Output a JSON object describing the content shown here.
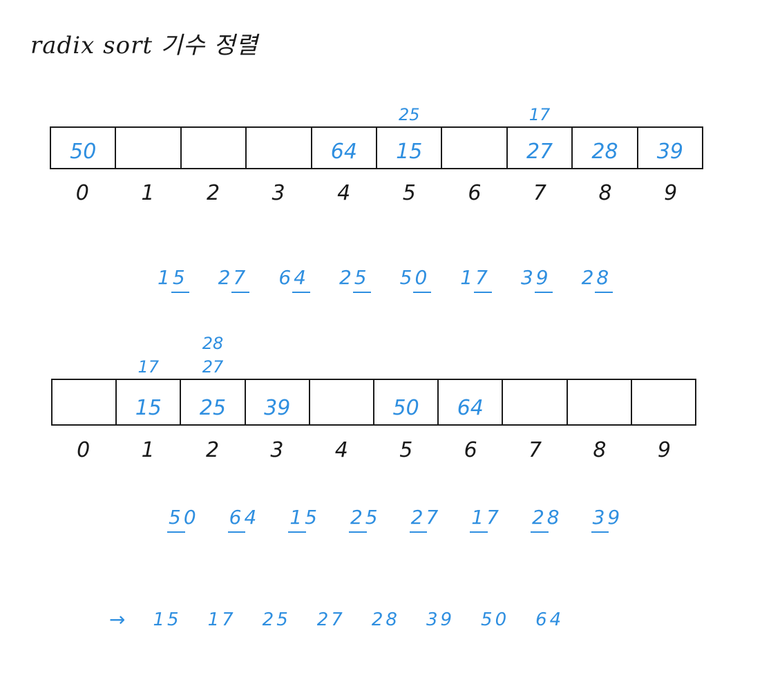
{
  "title": "radix sort 기수 정렬",
  "pass1": {
    "buckets": [
      {
        "index": "0",
        "values": [
          "50"
        ]
      },
      {
        "index": "1",
        "values": []
      },
      {
        "index": "2",
        "values": []
      },
      {
        "index": "3",
        "values": []
      },
      {
        "index": "4",
        "values": [
          "64"
        ]
      },
      {
        "index": "5",
        "values": [
          "15",
          "25"
        ]
      },
      {
        "index": "6",
        "values": []
      },
      {
        "index": "7",
        "values": [
          "27",
          "17"
        ]
      },
      {
        "index": "8",
        "values": [
          "28"
        ]
      },
      {
        "index": "9",
        "values": [
          "39"
        ]
      }
    ],
    "sequence": [
      {
        "lead": "1",
        "digit": "5"
      },
      {
        "lead": "2",
        "digit": "7"
      },
      {
        "lead": "6",
        "digit": "4"
      },
      {
        "lead": "2",
        "digit": "5"
      },
      {
        "lead": "5",
        "digit": "0"
      },
      {
        "lead": "1",
        "digit": "7"
      },
      {
        "lead": "3",
        "digit": "9"
      },
      {
        "lead": "2",
        "digit": "8"
      }
    ]
  },
  "pass2": {
    "buckets": [
      {
        "index": "0",
        "values": []
      },
      {
        "index": "1",
        "values": [
          "15",
          "17"
        ]
      },
      {
        "index": "2",
        "values": [
          "25",
          "27",
          "28"
        ]
      },
      {
        "index": "3",
        "values": [
          "39"
        ]
      },
      {
        "index": "4",
        "values": []
      },
      {
        "index": "5",
        "values": [
          "50"
        ]
      },
      {
        "index": "6",
        "values": [
          "64"
        ]
      },
      {
        "index": "7",
        "values": []
      },
      {
        "index": "8",
        "values": []
      },
      {
        "index": "9",
        "values": []
      }
    ],
    "sequence": [
      {
        "digit": "5",
        "tail": "0"
      },
      {
        "digit": "6",
        "tail": "4"
      },
      {
        "digit": "1",
        "tail": "5"
      },
      {
        "digit": "2",
        "tail": "5"
      },
      {
        "digit": "2",
        "tail": "7"
      },
      {
        "digit": "1",
        "tail": "7"
      },
      {
        "digit": "2",
        "tail": "8"
      },
      {
        "digit": "3",
        "tail": "9"
      }
    ]
  },
  "result": {
    "arrow": "→",
    "values": [
      "15",
      "17",
      "25",
      "27",
      "28",
      "39",
      "50",
      "64"
    ]
  }
}
